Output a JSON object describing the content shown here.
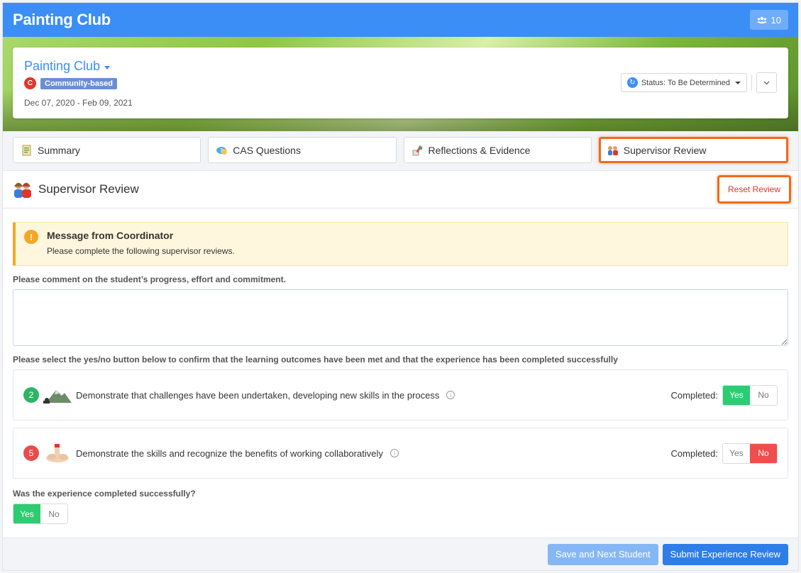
{
  "header": {
    "title": "Painting Club",
    "members_count": "10"
  },
  "experience": {
    "name": "Painting Club",
    "category_initial": "C",
    "category": "Community-based",
    "dates": "Dec 07, 2020 - Feb 09, 2021",
    "status_label": "Status: To Be Determined"
  },
  "tabs": [
    {
      "label": "Summary",
      "icon": "summary-icon"
    },
    {
      "label": "CAS Questions",
      "icon": "questions-icon"
    },
    {
      "label": "Reflections & Evidence",
      "icon": "reflections-icon"
    },
    {
      "label": "Supervisor Review",
      "icon": "supervisor-icon",
      "active": true
    }
  ],
  "section": {
    "title": "Supervisor Review",
    "reset_label": "Reset Review"
  },
  "alert": {
    "title": "Message from Coordinator",
    "body": "Please complete the following supervisor reviews."
  },
  "comment": {
    "label": "Please comment on the student’s progress, effort and commitment.",
    "value": ""
  },
  "outcomes_label": "Please select the yes/no button below to confirm that the learning outcomes have been met and that the experience has been completed successfully",
  "outcomes": [
    {
      "number": "2",
      "text": "Demonstrate that challenges have been undertaken, developing new skills in the process",
      "completed_label": "Completed:",
      "yes": "Yes",
      "no": "No",
      "selected": "yes"
    },
    {
      "number": "5",
      "text": "Demonstrate the skills and recognize the benefits of working collaboratively",
      "completed_label": "Completed:",
      "yes": "Yes",
      "no": "No",
      "selected": "no"
    }
  ],
  "success": {
    "label": "Was the experience completed successfully?",
    "yes": "Yes",
    "no": "No",
    "selected": "yes"
  },
  "footer": {
    "save_next": "Save and Next Student",
    "submit": "Submit Experience Review"
  },
  "colors": {
    "primary": "#3a8ef6",
    "highlight": "#f26a1b",
    "yes": "#2ecc71",
    "no": "#f04e4e",
    "warning": "#f5a623"
  }
}
